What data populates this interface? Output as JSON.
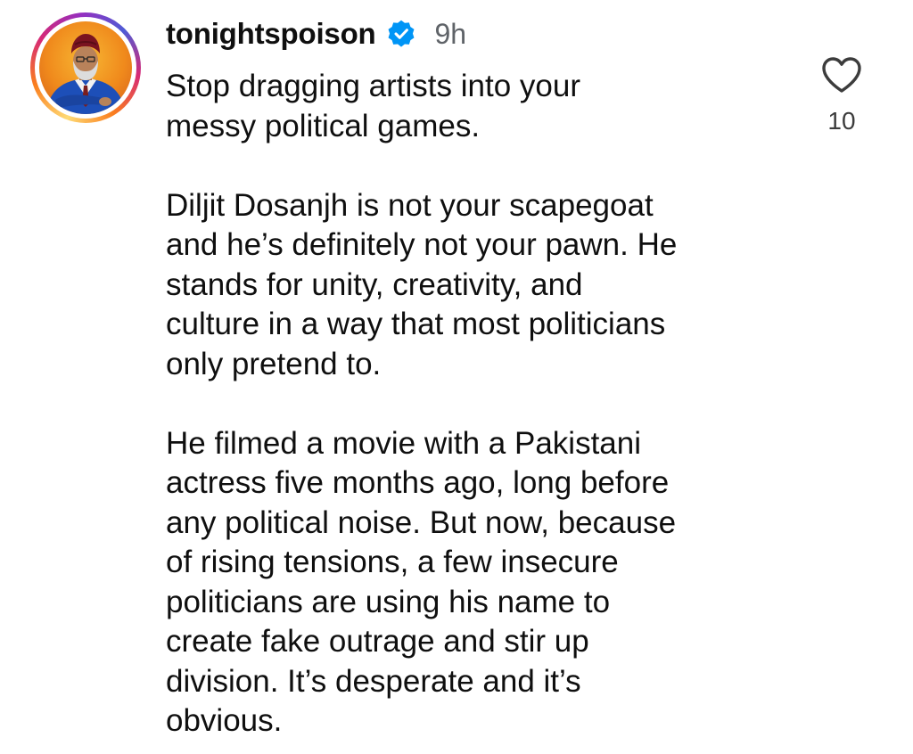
{
  "comment": {
    "username": "tonightspoison",
    "verified_icon": "verified-badge-icon",
    "timestamp": "9h",
    "paragraphs": [
      {
        "lines": [
          "Stop dragging artists into your",
          "messy political games."
        ]
      },
      {
        "lines": [
          "Diljit Dosanjh is not your scapegoat",
          "and he’s definitely not your pawn. He",
          "stands for unity, creativity, and",
          "culture in a way that most politicians",
          "only pretend to."
        ]
      },
      {
        "lines": [
          "He filmed a movie with a Pakistani",
          "actress five months ago, long before",
          "any political noise. But now, because",
          "of rising tensions, a few insecure",
          "politicians are using his name to",
          "create fake outrage and stir up",
          "division. It’s desperate and it’s",
          "obvious."
        ]
      }
    ],
    "like_icon": "heart-outline-icon",
    "like_count": "10"
  },
  "colors": {
    "text": "#0f0f0f",
    "muted": "#5f6368",
    "verified_blue": "#0095f6",
    "story_ring": [
      "#feda75",
      "#fa7e1e",
      "#d62976",
      "#962fbf",
      "#4f5bd5"
    ]
  }
}
